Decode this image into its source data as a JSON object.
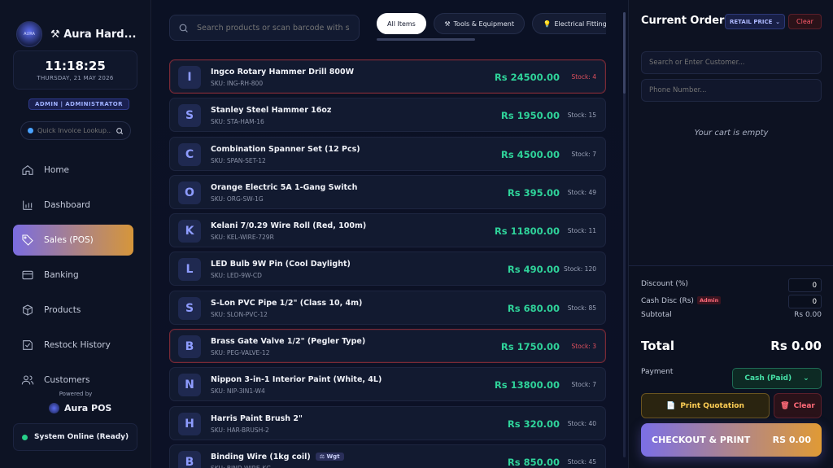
{
  "brand": {
    "name": "Aura Hard...",
    "logo_text": "AURA"
  },
  "clock": {
    "time": "11:18:25",
    "date": "THURSDAY, 21 MAY 2026"
  },
  "role": "ADMIN | ADMINISTRATOR",
  "quick_lookup": {
    "placeholder": "Quick Invoice Lookup..."
  },
  "nav": [
    {
      "label": "Home",
      "icon": "home-icon"
    },
    {
      "label": "Dashboard",
      "icon": "chart-icon"
    },
    {
      "label": "Sales (POS)",
      "icon": "tag-icon",
      "active": true
    },
    {
      "label": "Banking",
      "icon": "card-icon"
    },
    {
      "label": "Products",
      "icon": "box-icon"
    },
    {
      "label": "Restock History",
      "icon": "history-icon"
    },
    {
      "label": "Customers",
      "icon": "users-icon"
    }
  ],
  "powered": {
    "label": "Powered by",
    "name": "Aura POS"
  },
  "system_status": "System Online (Ready)",
  "search": {
    "placeholder": "Search products or scan barcode with s"
  },
  "categories": [
    {
      "label": "All Items",
      "icon": ""
    },
    {
      "label": "Tools & Equipment",
      "icon": "⚒"
    },
    {
      "label": "Electrical Fitting",
      "icon": "💡"
    }
  ],
  "products": [
    {
      "letter": "I",
      "name": "Ingco Rotary Hammer Drill 800W",
      "sku": "SKU: ING-RH-800",
      "price": "Rs 24500.00",
      "stock": "Stock: 4",
      "low": true,
      "tag": ""
    },
    {
      "letter": "S",
      "name": "Stanley Steel Hammer 16oz",
      "sku": "SKU: STA-HAM-16",
      "price": "Rs 1950.00",
      "stock": "Stock: 15",
      "low": false,
      "tag": ""
    },
    {
      "letter": "C",
      "name": "Combination Spanner Set (12 Pcs)",
      "sku": "SKU: SPAN-SET-12",
      "price": "Rs 4500.00",
      "stock": "Stock: 7",
      "low": false,
      "tag": ""
    },
    {
      "letter": "O",
      "name": "Orange Electric 5A 1-Gang Switch",
      "sku": "SKU: ORG-SW-1G",
      "price": "Rs 395.00",
      "stock": "Stock: 49",
      "low": false,
      "tag": ""
    },
    {
      "letter": "K",
      "name": "Kelani 7/0.29 Wire Roll (Red, 100m)",
      "sku": "SKU: KEL-WIRE-729R",
      "price": "Rs 11800.00",
      "stock": "Stock: 11",
      "low": false,
      "tag": ""
    },
    {
      "letter": "L",
      "name": "LED Bulb 9W Pin (Cool Daylight)",
      "sku": "SKU: LED-9W-CD",
      "price": "Rs 490.00",
      "stock": "Stock: 120",
      "low": false,
      "tag": ""
    },
    {
      "letter": "S",
      "name": "S-Lon PVC Pipe 1/2\" (Class 10, 4m)",
      "sku": "SKU: SLON-PVC-12",
      "price": "Rs 680.00",
      "stock": "Stock: 85",
      "low": false,
      "tag": ""
    },
    {
      "letter": "B",
      "name": "Brass Gate Valve 1/2\" (Pegler Type)",
      "sku": "SKU: PEG-VALVE-12",
      "price": "Rs 1750.00",
      "stock": "Stock: 3",
      "low": true,
      "tag": ""
    },
    {
      "letter": "N",
      "name": "Nippon 3-in-1 Interior Paint (White, 4L)",
      "sku": "SKU: NIP-3IN1-W4",
      "price": "Rs 13800.00",
      "stock": "Stock: 7",
      "low": false,
      "tag": ""
    },
    {
      "letter": "H",
      "name": "Harris Paint Brush 2\"",
      "sku": "SKU: HAR-BRUSH-2",
      "price": "Rs 320.00",
      "stock": "Stock: 40",
      "low": false,
      "tag": ""
    },
    {
      "letter": "B",
      "name": "Binding Wire (1kg coil)",
      "sku": "SKU: BIND-WIRE-KG",
      "price": "Rs 850.00",
      "stock": "Stock: 45",
      "low": false,
      "tag": "⚖ Wgt"
    }
  ],
  "order": {
    "title": "Current Order",
    "price_mode": "RETAIL PRICE",
    "clear_label": "Clear",
    "customer_placeholder": "Search or Enter Customer...",
    "phone_placeholder": "Phone Number...",
    "empty_text": "Your cart is empty",
    "discount_label": "Discount (%)",
    "discount_value": "0",
    "cash_disc_label": "Cash Disc (Rs)",
    "cash_disc_tag": "Admin",
    "cash_disc_value": "0",
    "subtotal_label": "Subtotal",
    "subtotal_value": "Rs 0.00",
    "total_label": "Total",
    "total_value": "Rs 0.00",
    "payment_label": "Payment",
    "payment_value": "Cash (Paid)",
    "print_quote_label": "Print Quotation",
    "clear_cart_label": "Clear",
    "checkout_label": "CHECKOUT & PRINT",
    "checkout_total": "RS 0.00"
  },
  "colors": {
    "accent_start": "#7b6fe6",
    "accent_end": "#e09a35",
    "price": "#2fd39a",
    "danger": "#ff5a6a",
    "online": "#27d08a"
  }
}
